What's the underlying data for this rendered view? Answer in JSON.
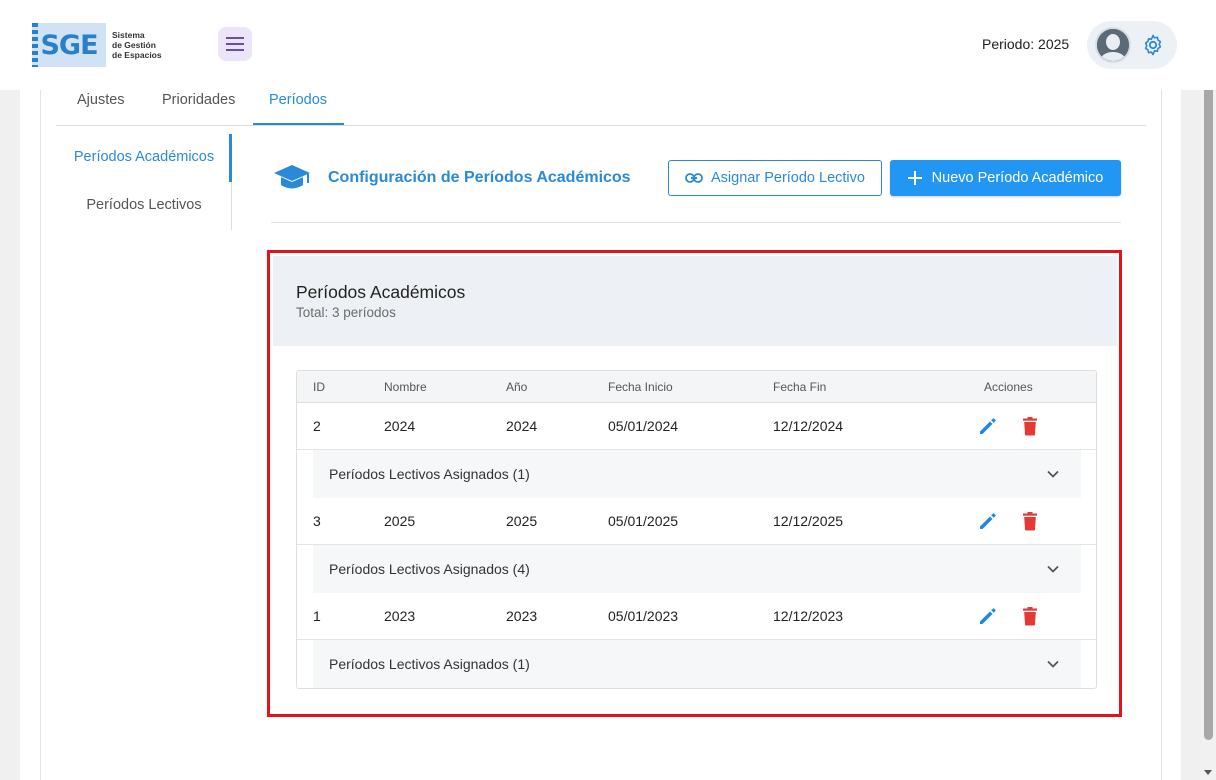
{
  "header": {
    "logo_text": "SGE",
    "logo_sub": [
      "Sistema",
      "de Gestión",
      "de Espacios"
    ],
    "periodo_label": "Periodo: 2025",
    "menu_icon": "hamburger-icon",
    "settings_icon": "gear-icon"
  },
  "tabs": [
    {
      "label": "Ajustes",
      "active": false
    },
    {
      "label": "Prioridades",
      "active": false
    },
    {
      "label": "Períodos",
      "active": true
    }
  ],
  "sidenav": [
    {
      "label": "Períodos Académicos",
      "active": true
    },
    {
      "label": "Períodos Lectivos",
      "active": false
    }
  ],
  "section": {
    "title": "Configuración de Períodos Académicos",
    "assign_button": "Asignar Período Lectivo",
    "new_button": "Nuevo Período Académico"
  },
  "panel": {
    "title": "Períodos Académicos",
    "subtitle": "Total: 3 períodos"
  },
  "table": {
    "columns": [
      "ID",
      "Nombre",
      "Año",
      "Fecha Inicio",
      "Fecha Fin",
      "Acciones"
    ],
    "rows": [
      {
        "id": "2",
        "nombre": "2024",
        "anio": "2024",
        "inicio": "05/01/2024",
        "fin": "12/12/2024",
        "assigned": "Períodos Lectivos Asignados (1)"
      },
      {
        "id": "3",
        "nombre": "2025",
        "anio": "2025",
        "inicio": "05/01/2025",
        "fin": "12/12/2025",
        "assigned": "Períodos Lectivos Asignados (4)"
      },
      {
        "id": "1",
        "nombre": "2023",
        "anio": "2023",
        "inicio": "05/01/2023",
        "fin": "12/12/2023",
        "assigned": "Períodos Lectivos Asignados (1)"
      }
    ]
  },
  "colors": {
    "accent": "#2a8ad8",
    "primary_button": "#2196f3",
    "delete": "#e53935",
    "highlight": "#e0141b"
  }
}
